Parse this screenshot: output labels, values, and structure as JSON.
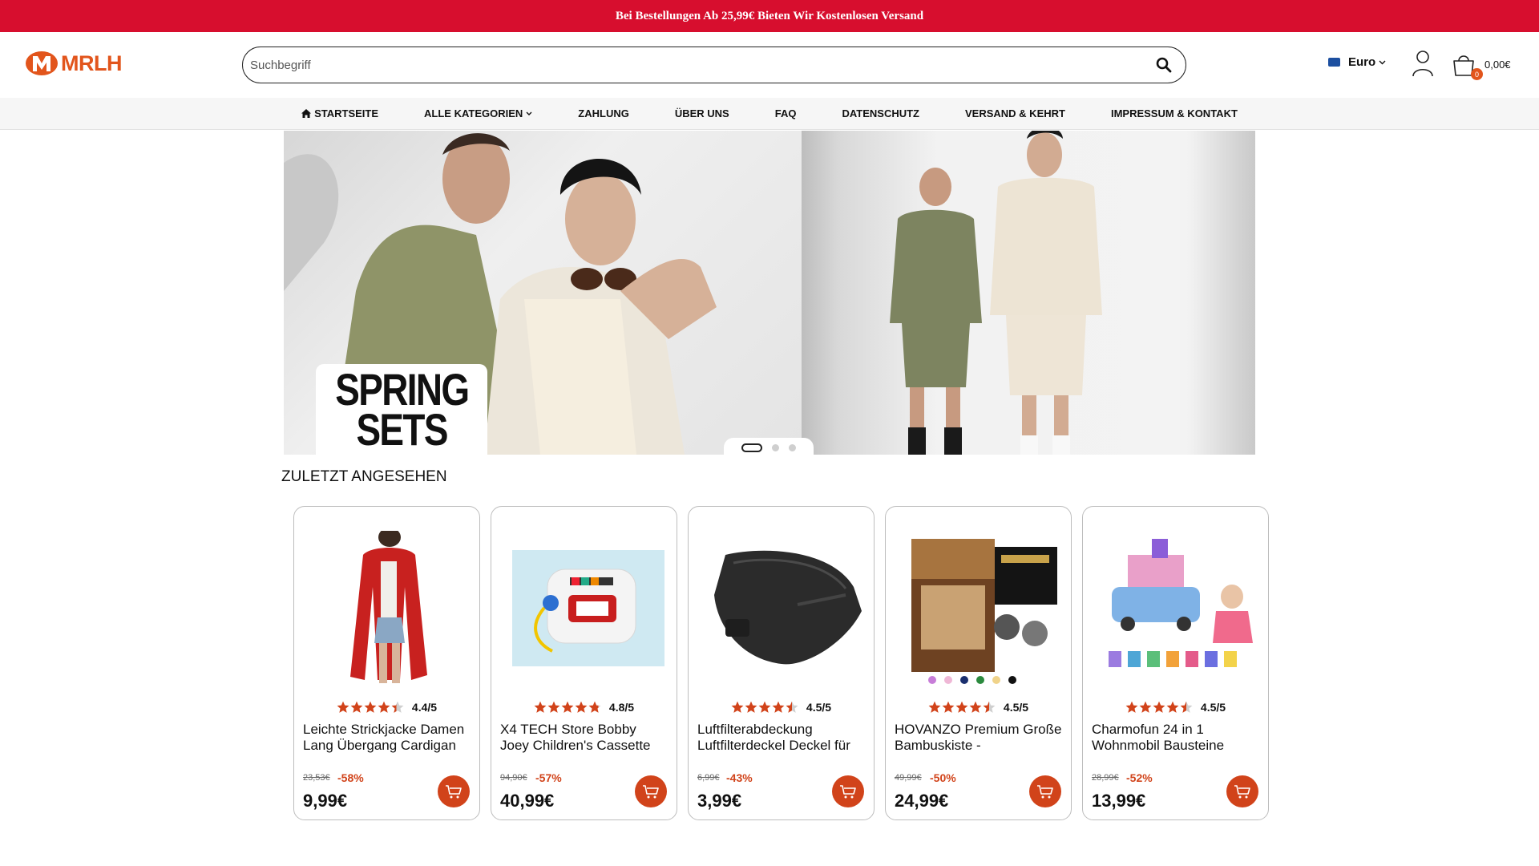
{
  "promo": {
    "text": "Bei Bestellungen Ab 25,99€ Bieten Wir Kostenlosen Versand"
  },
  "brand": {
    "name": "MRLH",
    "accent": "#e2551c",
    "promo_color": "#d70e2e"
  },
  "search": {
    "placeholder": "Suchbegriff"
  },
  "currency": {
    "label": "Euro"
  },
  "cart": {
    "count": "0",
    "total": "0,00€"
  },
  "nav": {
    "items": [
      {
        "label": "STARTSEITE",
        "icon": "home-icon"
      },
      {
        "label": "ALLE KATEGORIEN",
        "icon": "chevron-down-icon"
      },
      {
        "label": "ZAHLUNG"
      },
      {
        "label": "ÜBER UNS"
      },
      {
        "label": "FAQ"
      },
      {
        "label": "DATENSCHUTZ"
      },
      {
        "label": "VERSAND & KEHRT"
      },
      {
        "label": "IMPRESSUM & KONTAKT"
      }
    ]
  },
  "hero": {
    "headline_line1": "SPRING",
    "headline_line2": "SETS",
    "slides": 3,
    "active_slide": 1
  },
  "recent": {
    "title": "ZULETZT ANGESEHEN",
    "products": [
      {
        "rating": "4.4/5",
        "rating_value": 4.4,
        "title": "Leichte Strickjacke Damen Lang Übergang Cardigan",
        "old_price": "23,53€",
        "discount": "-58%",
        "price": "9,99€",
        "image": "red-cardigan"
      },
      {
        "rating": "4.8/5",
        "rating_value": 4.8,
        "title": "X4 TECH Store Bobby Joey Children's Cassette",
        "old_price": "94,90€",
        "discount": "-57%",
        "price": "40,99€",
        "image": "cassette-player"
      },
      {
        "rating": "4.5/5",
        "rating_value": 4.5,
        "title": "Luftfilterabdeckung Luftfilterdeckel Deckel für",
        "old_price": "6,99€",
        "discount": "-43%",
        "price": "3,99€",
        "image": "air-filter-cover"
      },
      {
        "rating": "4.5/5",
        "rating_value": 4.5,
        "title": "HOVANZO Premium Große Bambuskiste -",
        "old_price": "49,99€",
        "discount": "-50%",
        "price": "24,99€",
        "image": "bamboo-box"
      },
      {
        "rating": "4.5/5",
        "rating_value": 4.5,
        "title": "Charmofun 24 in 1 Wohnmobil Bausteine",
        "old_price": "28,99€",
        "discount": "-52%",
        "price": "13,99€",
        "image": "building-blocks"
      }
    ]
  }
}
